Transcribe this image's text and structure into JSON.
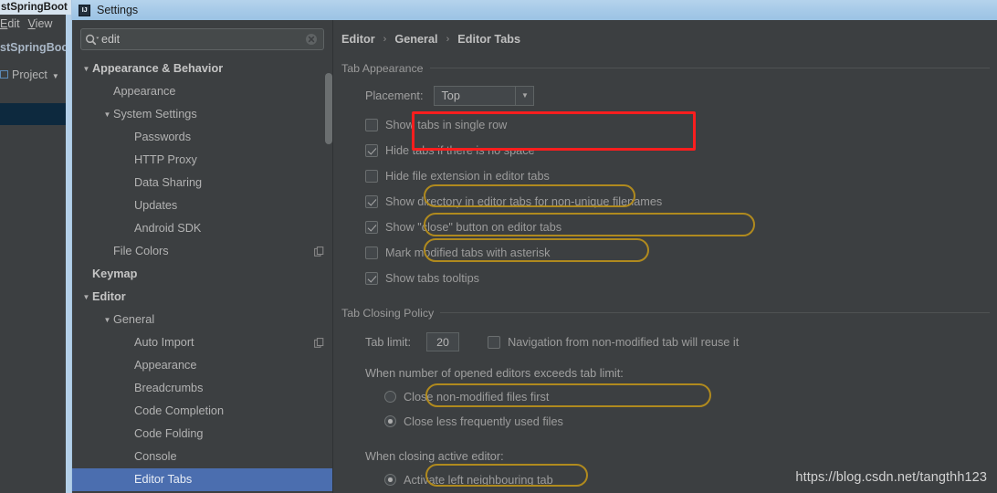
{
  "ide": {
    "window_title": "stSpringBoot",
    "menu_items": [
      "Edit",
      "View"
    ],
    "nav_title": "stSpringBoo",
    "toolwindow_label": "Project",
    "toolwindow_icon": "project-panel-icon",
    "toolwindow_arrow_icon": "chevron-down-icon"
  },
  "dialog": {
    "title": "Settings",
    "app_icon": "intellij-idea-icon",
    "search": {
      "value": "edit",
      "placeholder": "",
      "icon": "search-icon",
      "clear_icon": "clear-icon"
    },
    "tree": [
      {
        "label": "Appearance & Behavior",
        "indent": 0,
        "arrow": "expanded",
        "bold": true,
        "selected": false,
        "badge": false
      },
      {
        "label": "Appearance",
        "indent": 1,
        "arrow": "none",
        "bold": false,
        "selected": false,
        "badge": false
      },
      {
        "label": "System Settings",
        "indent": 1,
        "arrow": "expanded",
        "bold": false,
        "selected": false,
        "badge": false
      },
      {
        "label": "Passwords",
        "indent": 2,
        "arrow": "none",
        "bold": false,
        "selected": false,
        "badge": false
      },
      {
        "label": "HTTP Proxy",
        "indent": 2,
        "arrow": "none",
        "bold": false,
        "selected": false,
        "badge": false
      },
      {
        "label": "Data Sharing",
        "indent": 2,
        "arrow": "none",
        "bold": false,
        "selected": false,
        "badge": false
      },
      {
        "label": "Updates",
        "indent": 2,
        "arrow": "none",
        "bold": false,
        "selected": false,
        "badge": false
      },
      {
        "label": "Android SDK",
        "indent": 2,
        "arrow": "none",
        "bold": false,
        "selected": false,
        "badge": false
      },
      {
        "label": "File Colors",
        "indent": 1,
        "arrow": "none",
        "bold": false,
        "selected": false,
        "badge": true
      },
      {
        "label": "Keymap",
        "indent": 0,
        "arrow": "none",
        "bold": true,
        "selected": false,
        "badge": false
      },
      {
        "label": "Editor",
        "indent": 0,
        "arrow": "expanded",
        "bold": true,
        "selected": false,
        "badge": false
      },
      {
        "label": "General",
        "indent": 1,
        "arrow": "expanded",
        "bold": false,
        "selected": false,
        "badge": false
      },
      {
        "label": "Auto Import",
        "indent": 2,
        "arrow": "none",
        "bold": false,
        "selected": false,
        "badge": true
      },
      {
        "label": "Appearance",
        "indent": 2,
        "arrow": "none",
        "bold": false,
        "selected": false,
        "badge": false
      },
      {
        "label": "Breadcrumbs",
        "indent": 2,
        "arrow": "none",
        "bold": false,
        "selected": false,
        "badge": false
      },
      {
        "label": "Code Completion",
        "indent": 2,
        "arrow": "none",
        "bold": false,
        "selected": false,
        "badge": false
      },
      {
        "label": "Code Folding",
        "indent": 2,
        "arrow": "none",
        "bold": false,
        "selected": false,
        "badge": false
      },
      {
        "label": "Console",
        "indent": 2,
        "arrow": "none",
        "bold": false,
        "selected": false,
        "badge": false
      },
      {
        "label": "Editor Tabs",
        "indent": 2,
        "arrow": "none",
        "bold": false,
        "selected": true,
        "badge": false
      }
    ],
    "breadcrumb": [
      "Editor",
      "General",
      "Editor Tabs"
    ],
    "breadcrumb_separator": "›",
    "tab_appearance": {
      "group_title": "Tab Appearance",
      "placement_label": "Placement:",
      "placement_value": "Top",
      "placement_arrow_icon": "triangle-down-icon",
      "checkboxes": [
        {
          "label": "Show tabs in single row",
          "checked": false
        },
        {
          "label": "Hide tabs if there is no space",
          "checked": true
        },
        {
          "label": "Hide file extension in editor tabs",
          "checked": false
        },
        {
          "label": "Show directory in editor tabs for non-unique filenames",
          "checked": true
        },
        {
          "label": "Show \"close\" button on editor tabs",
          "checked": true
        },
        {
          "label": "Mark modified tabs with asterisk",
          "checked": false
        },
        {
          "label": "Show tabs tooltips",
          "checked": true
        }
      ]
    },
    "tab_closing_policy": {
      "group_title": "Tab Closing Policy",
      "tab_limit_label": "Tab limit:",
      "tab_limit_value": "20",
      "navigation_checkbox": {
        "label": "Navigation from non-modified tab will reuse it",
        "checked": false
      },
      "exceeds_label": "When number of opened editors exceeds tab limit:",
      "exceeds_options": [
        {
          "label": "Close non-modified files first",
          "checked": false
        },
        {
          "label": "Close less frequently used files",
          "checked": true
        }
      ],
      "closing_active_label": "When closing active editor:",
      "closing_active_options": [
        {
          "label": "Activate left neighbouring tab",
          "checked": true
        }
      ]
    }
  },
  "annotations": {
    "red_box_target": "Show tabs in single row",
    "red_box_color": "#fb1e1e",
    "highlight_color": "#b08a1e",
    "highlighted_items": [
      "Hide file extension in editor tabs",
      "Show directory in editor tabs for non-unique filenames",
      "Show \"close\" button on editor tabs",
      "When number of opened editors exceeds tab limit:",
      "When closing active editor:"
    ]
  },
  "watermark": {
    "text": "https://blog.csdn.net/tangthh123"
  }
}
